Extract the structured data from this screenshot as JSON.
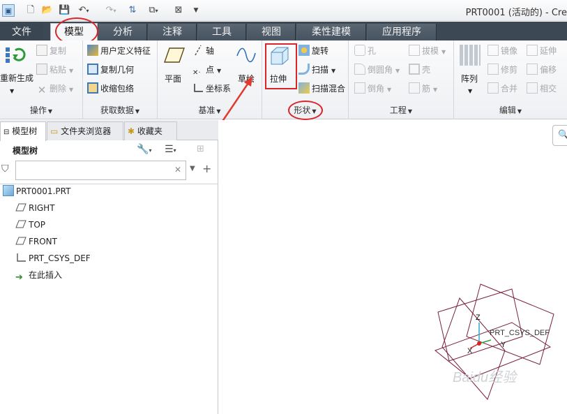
{
  "window": {
    "title": "PRT0001 (活动的) - Cre"
  },
  "tabs": [
    {
      "label": "文件"
    },
    {
      "label": "模型"
    },
    {
      "label": "分析"
    },
    {
      "label": "注释"
    },
    {
      "label": "工具"
    },
    {
      "label": "视图"
    },
    {
      "label": "柔性建模"
    },
    {
      "label": "应用程序"
    }
  ],
  "ribbon": {
    "operations": {
      "label": "操作",
      "regenerate": "重新生成",
      "copy": "复制",
      "paste": "粘贴",
      "delete": "删除"
    },
    "get_data": {
      "label": "获取数据",
      "udf": "用户定义特征",
      "copy_geom": "复制几何",
      "shrinkwrap": "收缩包络"
    },
    "datum": {
      "label": "基准",
      "plane": "平面",
      "axis": "轴",
      "point": "点",
      "csys": "坐标系",
      "sketch": "草绘"
    },
    "shapes": {
      "label": "形状",
      "extrude": "拉伸",
      "revolve": "旋转",
      "sweep": "扫描",
      "swept_blend": "扫描混合"
    },
    "engineering": {
      "label": "工程",
      "hole": "孔",
      "round": "倒圆角",
      "chamfer": "倒角",
      "draft": "拔模",
      "shell": "壳",
      "rib": "筋"
    },
    "editing": {
      "label": "编辑",
      "pattern": "阵列",
      "mirror": "镜像",
      "trim": "修剪",
      "merge": "合并",
      "extend": "延伸",
      "offset": "偏移",
      "intersect": "相交"
    }
  },
  "panel": {
    "tabs": [
      "模型树",
      "文件夹浏览器",
      "收藏夹"
    ],
    "tree_title": "模型树",
    "filter_placeholder": "",
    "items": [
      "PRT0001.PRT",
      "RIGHT",
      "TOP",
      "FRONT",
      "PRT_CSYS_DEF",
      "在此插入"
    ]
  },
  "viewport": {
    "csys_label": "PRT_CSYS_DEF",
    "axis_z": "Z",
    "axis_x": "X",
    "axis_y": "Y",
    "watermark": "Baidu经验"
  },
  "colors": {
    "tabbar": "#3c4854",
    "accent_red": "#d8262b",
    "datum_planes": "#7a1f3a"
  }
}
